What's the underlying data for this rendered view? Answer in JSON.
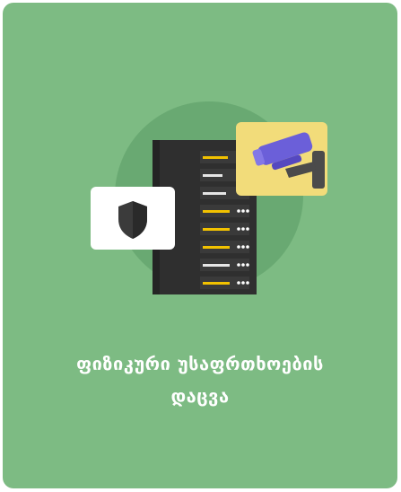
{
  "card": {
    "title_line1": "ფიზიკური უსაფრთხოების",
    "title_line2": "დაცვა",
    "background": "#7dbb83",
    "accent_circle": "#69a972"
  },
  "illustration": {
    "icons": [
      "shield-icon",
      "server-rack",
      "security-camera-icon"
    ],
    "colors": {
      "server": "#2b2b2b",
      "drive_light": "#f2c200",
      "shield": "#3b3b3b",
      "camera_card": "#f2dc7a",
      "camera": "#6b5fd9"
    }
  }
}
